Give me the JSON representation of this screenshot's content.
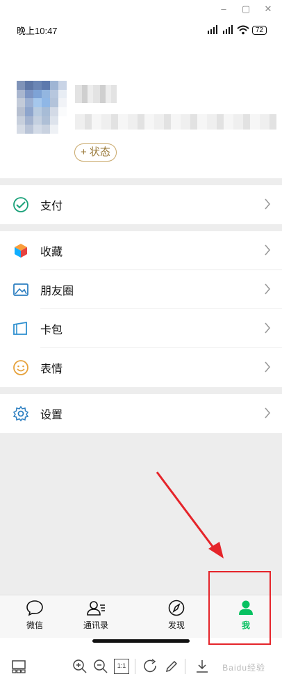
{
  "window": {
    "minimize_icon": "minimize-icon",
    "maximize_icon": "maximize-icon",
    "close_icon": "close-icon"
  },
  "status_bar": {
    "time": "晚上10:47",
    "battery": "72"
  },
  "profile": {
    "status_button": "+ 状态"
  },
  "menu": {
    "pay": "支付",
    "favorites": "收藏",
    "moments": "朋友圈",
    "cards": "卡包",
    "stickers": "表情",
    "settings": "设置"
  },
  "tabs": [
    {
      "label": "微信",
      "icon": "chat-bubble-icon"
    },
    {
      "label": "通讯录",
      "icon": "contacts-icon"
    },
    {
      "label": "发现",
      "icon": "compass-icon"
    },
    {
      "label": "我",
      "icon": "person-icon",
      "active": true
    }
  ],
  "colors": {
    "accent": "#07c160",
    "annotation": "#e5242a",
    "status_gold": "#c9a86a",
    "background_gray": "#ededed"
  },
  "watermark": "Baidu经验",
  "toolbar": {
    "actual_size": "1:1"
  }
}
